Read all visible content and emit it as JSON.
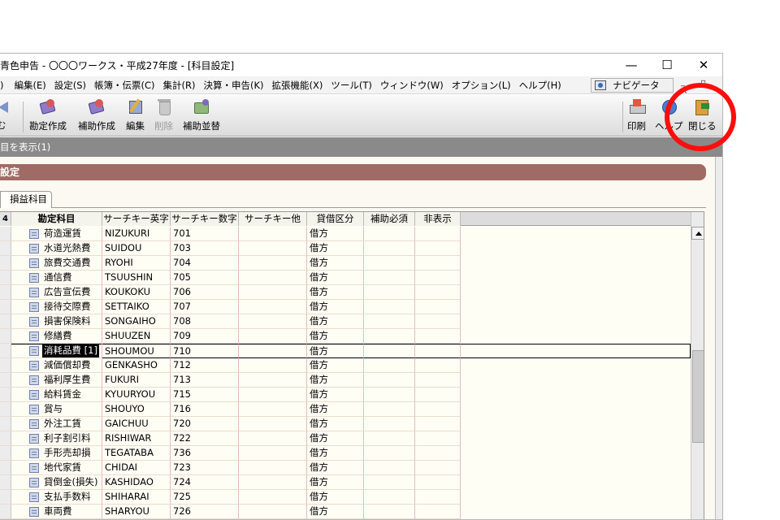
{
  "window": {
    "title": "青色申告 - 〇〇〇ワークス・平成27年度 - [科目設定]",
    "controls": {
      "minimize": "—",
      "maximize": "☐",
      "close": "✕"
    }
  },
  "menu": {
    "items": [
      "編集(E)",
      "設定(S)",
      "帳簿・伝票(C)",
      "集計(R)",
      "決算・申告(K)",
      "拡張機能(X)",
      "ツール(T)",
      "ウィンドウ(W)",
      "オプション(L)",
      "ヘルプ(H)"
    ],
    "navigator_label": "ナビゲータ",
    "partial_left": ")"
  },
  "toolbar": {
    "left_partial_label": "む",
    "buttons": [
      {
        "label": "勘定作成",
        "icon": "account-create-icon",
        "enabled": true
      },
      {
        "label": "補助作成",
        "icon": "sub-account-create-icon",
        "enabled": true
      },
      {
        "label": "編集",
        "icon": "edit-icon",
        "enabled": true
      },
      {
        "label": "削除",
        "icon": "trash-icon",
        "enabled": false
      },
      {
        "label": "補助並替",
        "icon": "sort-icon",
        "enabled": true
      }
    ],
    "right_buttons": [
      {
        "label": "印刷",
        "icon": "print-icon"
      },
      {
        "label": "ヘルプ",
        "icon": "help-icon"
      },
      {
        "label": "閉じる",
        "icon": "close-door-icon"
      }
    ]
  },
  "subtoolbar": {
    "label": "目を表示(1)"
  },
  "section": {
    "title": "設定"
  },
  "tab": {
    "label": "損益科目"
  },
  "grid": {
    "corner_label": "4",
    "columns": [
      "勘定科目",
      "サーチキー英字",
      "サーチキー数字",
      "サーチキー他",
      "貸借区分",
      "補助必須",
      "非表示"
    ],
    "rows": [
      {
        "name": "荷造運賃",
        "alpha": "NIZUKURI",
        "num": "701",
        "other": "",
        "dc": "借方"
      },
      {
        "name": "水道光熱費",
        "alpha": "SUIDOU",
        "num": "703",
        "other": "",
        "dc": "借方"
      },
      {
        "name": "旅費交通費",
        "alpha": "RYOHI",
        "num": "704",
        "other": "",
        "dc": "借方"
      },
      {
        "name": "通信費",
        "alpha": "TSUUSHIN",
        "num": "705",
        "other": "",
        "dc": "借方"
      },
      {
        "name": "広告宣伝費",
        "alpha": "KOUKOKU",
        "num": "706",
        "other": "",
        "dc": "借方"
      },
      {
        "name": "接待交際費",
        "alpha": "SETTAIKO",
        "num": "707",
        "other": "",
        "dc": "借方"
      },
      {
        "name": "損害保険料",
        "alpha": "SONGAIHO",
        "num": "708",
        "other": "",
        "dc": "借方"
      },
      {
        "name": "修繕費",
        "alpha": "SHUUZEN",
        "num": "709",
        "other": "",
        "dc": "借方"
      },
      {
        "name": "消耗品費 [1]",
        "alpha": "SHOUMOU",
        "num": "710",
        "other": "",
        "dc": "借方",
        "selected": true
      },
      {
        "name": "減価償却費",
        "alpha": "GENKASHO",
        "num": "712",
        "other": "",
        "dc": "借方"
      },
      {
        "name": "福利厚生費",
        "alpha": "FUKURI",
        "num": "713",
        "other": "",
        "dc": "借方"
      },
      {
        "name": "給料賃金",
        "alpha": "KYUURYOU",
        "num": "715",
        "other": "",
        "dc": "借方"
      },
      {
        "name": "賞与",
        "alpha": "SHOUYO",
        "num": "716",
        "other": "",
        "dc": "借方"
      },
      {
        "name": "外注工賃",
        "alpha": "GAICHUU",
        "num": "720",
        "other": "",
        "dc": "借方"
      },
      {
        "name": "利子割引料",
        "alpha": "RISHIWAR",
        "num": "722",
        "other": "",
        "dc": "借方"
      },
      {
        "name": "手形売却損",
        "alpha": "TEGATABA",
        "num": "736",
        "other": "",
        "dc": "借方"
      },
      {
        "name": "地代家賃",
        "alpha": "CHIDAI",
        "num": "723",
        "other": "",
        "dc": "借方"
      },
      {
        "name": "貸倒金(損失)",
        "alpha": "KASHIDAO",
        "num": "724",
        "other": "",
        "dc": "借方"
      },
      {
        "name": "支払手数料",
        "alpha": "SHIHARAI",
        "num": "725",
        "other": "",
        "dc": "借方"
      },
      {
        "name": "車両費",
        "alpha": "SHARYOU",
        "num": "726",
        "other": "",
        "dc": "借方"
      }
    ]
  },
  "annotation": {
    "color": "#ff0d0d"
  }
}
